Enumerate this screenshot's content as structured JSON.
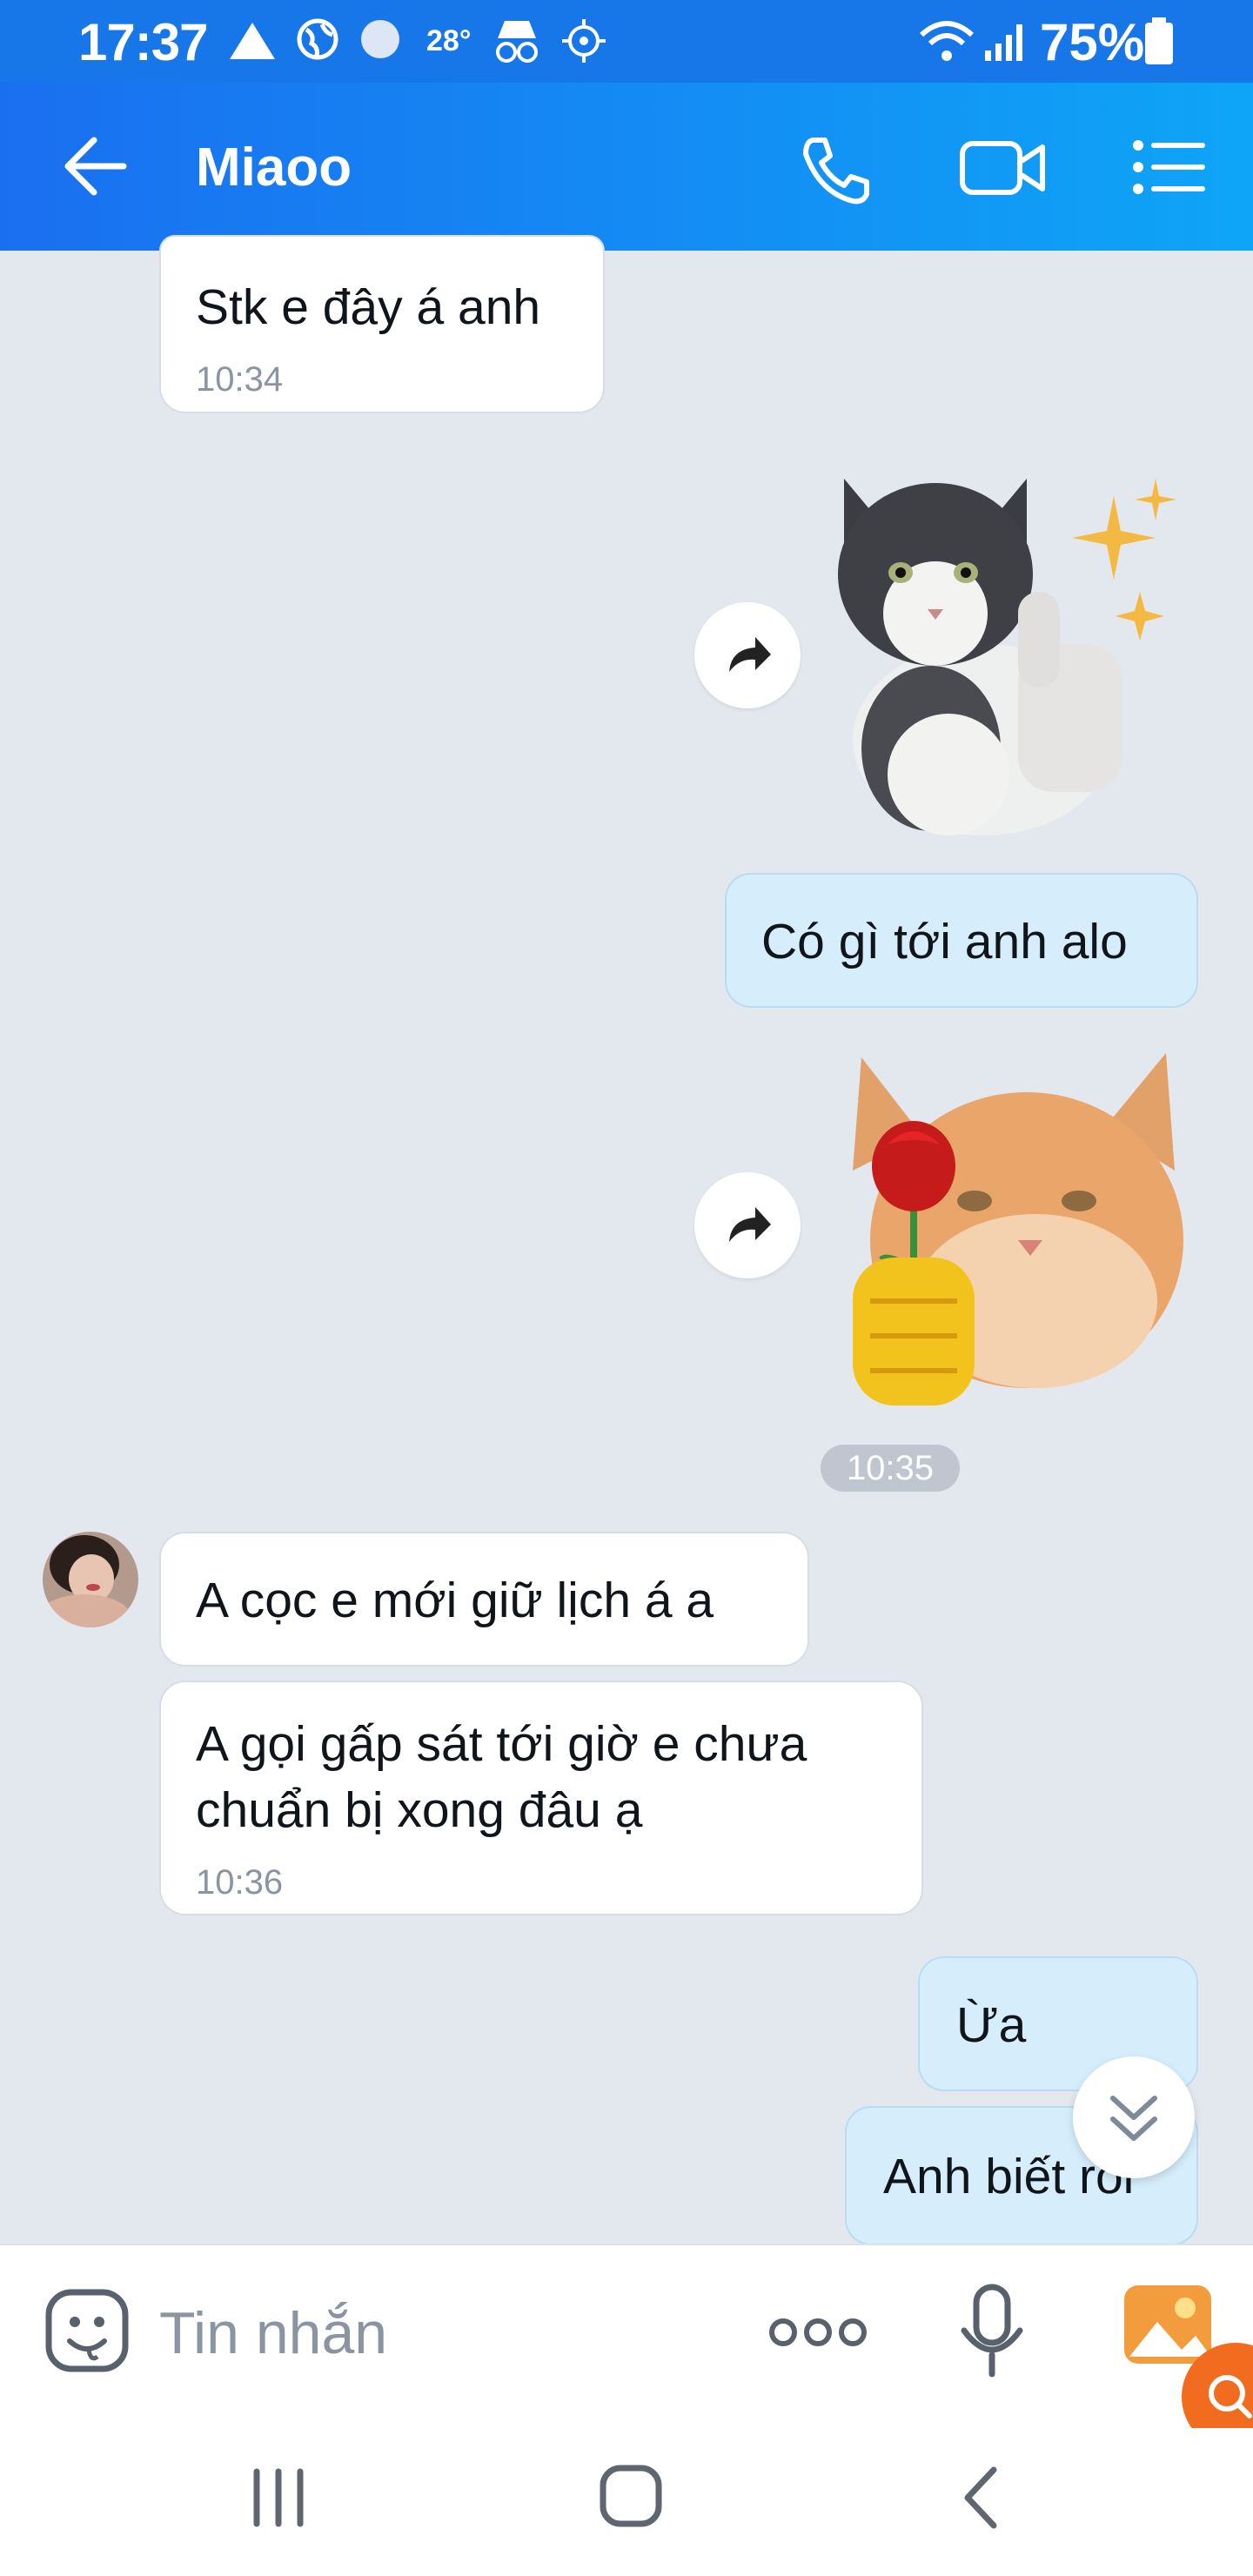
{
  "status_bar": {
    "time": "17:37",
    "temperature": "28°",
    "battery": "75%"
  },
  "header": {
    "title": "Miaoo"
  },
  "messages": [
    {
      "text": "Stk e đây á anh",
      "time": "10:34"
    },
    {
      "text": "Có gì tới anh alo"
    },
    {
      "time_divider": "10:35"
    },
    {
      "text": "A cọc e mới giữ lịch á a"
    },
    {
      "line1": "A gọi gấp sát tới giờ e chưa",
      "line2": "chuẩn bị xong đâu ạ",
      "time": "10:36"
    },
    {
      "text": "Ừa"
    },
    {
      "text": "Anh biết rồi"
    }
  ],
  "composer": {
    "placeholder": "Tin nhắn"
  },
  "colors": {
    "header_start": "#1a6ff0",
    "header_end": "#0ea5f7",
    "outgoing_bubble": "#d6eefc",
    "incoming_bubble": "#ffffff",
    "chat_background": "#e3e8ef"
  }
}
